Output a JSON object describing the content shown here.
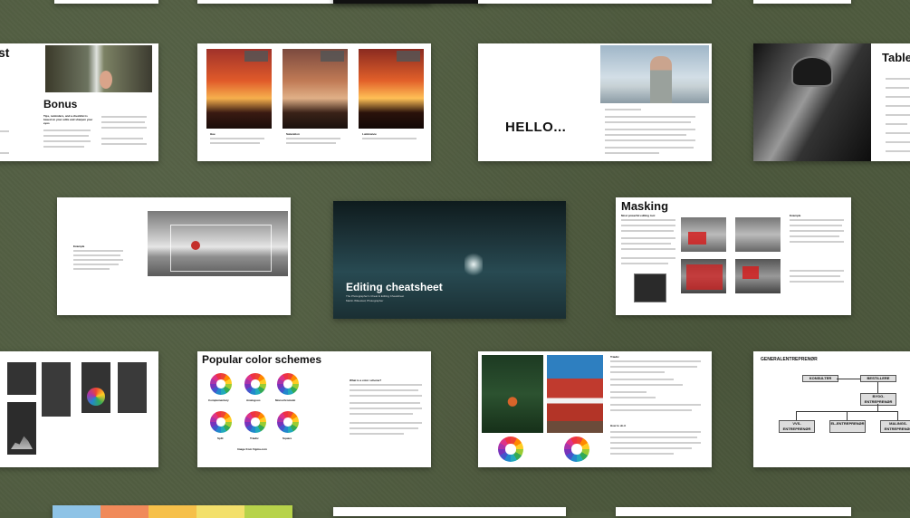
{
  "slides": {
    "bonus": {
      "title_fragment": "st",
      "heading": "Bonus",
      "subheading": "Tips, reminders, and a checklist is based on your edits and sharpen your eyes"
    },
    "sunsets": {
      "labels": [
        "Hue",
        "Saturation",
        "Luminance"
      ]
    },
    "hello": {
      "heading": "HELLO..."
    },
    "table": {
      "heading": "Table"
    },
    "example_left": {
      "label": "Example"
    },
    "cover": {
      "title": "Editing cheatsheet",
      "subtitle": "The Photographer's Cheat & Editing Cheatsheet",
      "author": "Martin Wikestad, Photographer"
    },
    "masking": {
      "heading": "Masking",
      "subheading": "Most powerful editing tool",
      "example_label": "Example"
    },
    "color_schemes": {
      "heading": "Popular color schemes",
      "wheels": [
        "Complementary",
        "Analogous",
        "Monochromatic",
        "Split",
        "Triadic",
        "Square"
      ],
      "credit": "Image from Figma.com",
      "side_heading": "What is a color scheme?"
    },
    "triadic": {
      "heading": "Triadic",
      "howto": "How to do it"
    },
    "org": {
      "heading": "GENERALENTREPRENØR",
      "nodes": [
        "KONSULTER",
        "BESTILLERE",
        "BYGG-ENTREPRENØR",
        "VVS-ENTREPRENØR",
        "EL-ENTREPRENØR",
        "MALINGS-ENTREPRENØR"
      ]
    }
  },
  "colors": {
    "background": "#4f5b3f",
    "slide": "#ffffff",
    "mask_red": "#d21f1f",
    "cover_dark": "#1d3236"
  }
}
